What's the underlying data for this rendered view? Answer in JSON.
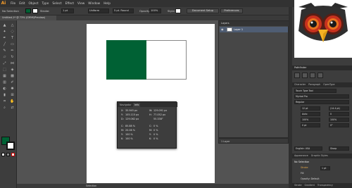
{
  "app": {
    "logo": "Ai"
  },
  "menu": [
    "File",
    "Edit",
    "Object",
    "Type",
    "Select",
    "Effect",
    "View",
    "Window",
    "Help"
  ],
  "control_bar": {
    "selection_label": "No Selection",
    "fill_color": "#006134",
    "stroke_label": "Stroke:",
    "stroke_value": "1 pt",
    "profile_value": "Uniform",
    "brush_value": "5 pt. Round",
    "opacity_label": "Opacity:",
    "opacity_value": "100%",
    "style_label": "Style:",
    "document_setup": "Document Setup",
    "preferences": "Preferences"
  },
  "document_tab": {
    "title": "Untitled-1* @ 73% (CMYK/Preview)"
  },
  "status_bar": {
    "tool": "Selection"
  },
  "info_panel": {
    "tabs": [
      "Navigator",
      "Info"
    ],
    "rows": [
      {
        "label": "X:",
        "value": "35.945 px",
        "label2": "W:",
        "value2": "129.091 px"
      },
      {
        "label": "Y:",
        "value": "105.115 px",
        "label2": "H:",
        "value2": "77.052 px"
      },
      {
        "label": "D:",
        "value": "129.062 px",
        "label2": "",
        "value2": "55.338°"
      },
      {
        "label": "C:",
        "value": "85.88 %",
        "label2": "C:",
        "value2": "0 %"
      },
      {
        "label": "M:",
        "value": "20.06 %",
        "label2": "M:",
        "value2": "0 %"
      },
      {
        "label": "Y:",
        "value": "100 %",
        "label2": "Y:",
        "value2": "0 %"
      },
      {
        "label": "K:",
        "value": "100 %",
        "label2": "K:",
        "value2": "0 %"
      }
    ]
  },
  "layers_panel": {
    "title": "Layers",
    "layer_name": "Layer 1",
    "footer": "1 Layer"
  },
  "right_panels": {
    "pathfinder_label": "Pathfinder",
    "character_tabs": [
      "Character",
      "Paragraph",
      "OpenType"
    ],
    "font_search": "Touch Type Tool",
    "font_family": "Myriad Pro",
    "font_style": "Regular",
    "font_size": "12 pt",
    "leading": "(14.4 pt)",
    "kerning": "Auto",
    "tracking": "0",
    "scale_h": "100%",
    "scale_v": "100%",
    "baseline": "0 pt",
    "rotation": "0°",
    "language": "English: USA",
    "aa": "Sharp",
    "appearance_tabs": [
      "Appearance",
      "Graphic Styles"
    ],
    "appearance_title": "No Selection",
    "stroke_row": "Stroke",
    "stroke_weight": "1 pt",
    "fill_row": "Fill",
    "opacity_row": "Opacity: Default",
    "bottom_tabs": [
      "Stroke",
      "Gradient",
      "Transparency"
    ]
  }
}
